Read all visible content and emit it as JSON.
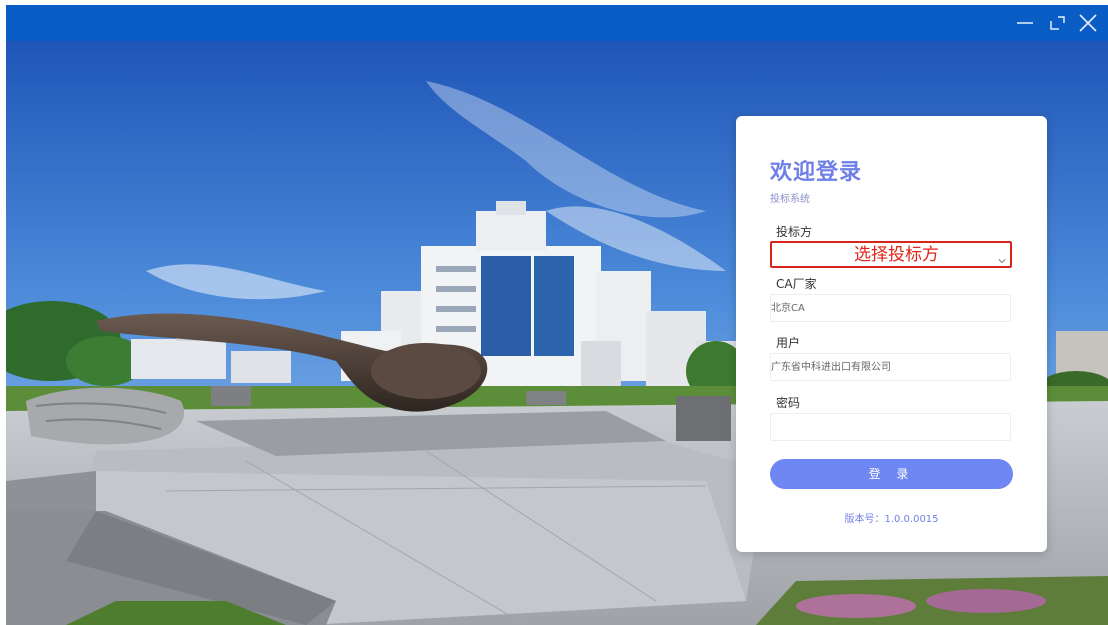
{
  "window": {
    "controls": [
      "minimize-icon",
      "restore-icon",
      "close-icon"
    ],
    "titlebar_color": "#0b5dc6"
  },
  "login": {
    "title": "欢迎登录",
    "subtitle": "投标系统",
    "bidder_label": "投标方",
    "bidder_placeholder": "选择投标方",
    "ca_label": "CA厂家",
    "ca_value": "北京CA",
    "user_label": "用户",
    "user_value": "广东省中科进出口有限公司",
    "password_label": "密码",
    "password_value": "",
    "login_button": "登 录",
    "version": "版本号：1.0.0.0015",
    "accent_color": "#6e87f2",
    "highlight_color": "#d9241c"
  }
}
